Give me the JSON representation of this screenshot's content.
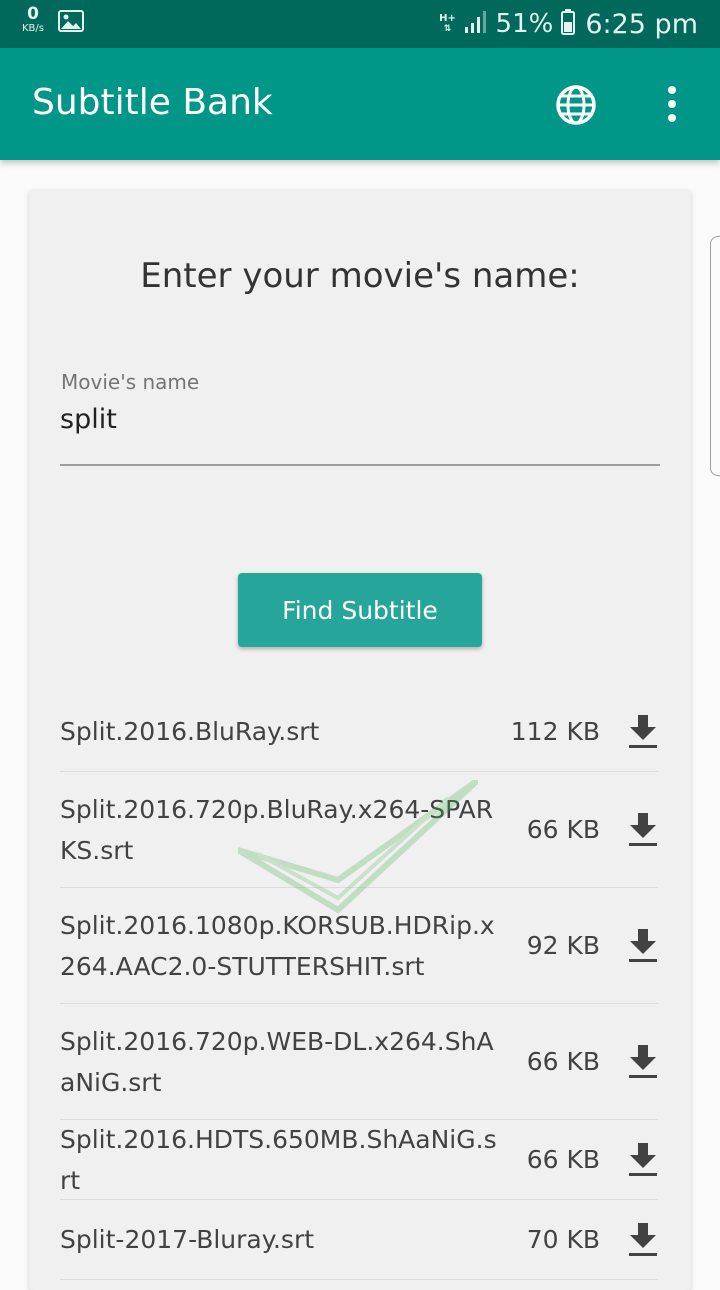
{
  "status_bar": {
    "speed_value": "0",
    "speed_unit": "KB/s",
    "network_type": "H+",
    "battery_percent": "51%",
    "time": "6:25 pm",
    "icons": [
      "gallery-icon",
      "network-arrows-icon",
      "signal-bars-icon",
      "battery-icon"
    ]
  },
  "app_bar": {
    "title": "Subtitle Bank",
    "icons": [
      "globe-icon",
      "more-vert-icon"
    ]
  },
  "search": {
    "prompt": "Enter your movie's name:",
    "field_label": "Movie's name",
    "field_value": "split",
    "button_label": "Find Subtitle"
  },
  "results": [
    {
      "name": "Split.2016.BluRay.srt",
      "size": "112 KB"
    },
    {
      "name": "Split.2016.720p.BluRay.x264-SPARKS.srt",
      "size": "66 KB"
    },
    {
      "name": "Split.2016.1080p.KORSUB.HDRip.x264.AAC2.0-STUTTERSHIT.srt",
      "size": "92 KB"
    },
    {
      "name": "Split.2016.720p.WEB-DL.x264.ShAaNiG.srt",
      "size": "66 KB"
    },
    {
      "name": "Split.2016.HDTS.650MB.ShAaNiG.srt",
      "size": "66 KB"
    },
    {
      "name": "Split-2017-Bluray.srt",
      "size": "70 KB"
    }
  ],
  "colors": {
    "status_bar": "#00695c",
    "app_bar": "#009688",
    "button": "#26a69a",
    "card": "#f0f0f0"
  }
}
